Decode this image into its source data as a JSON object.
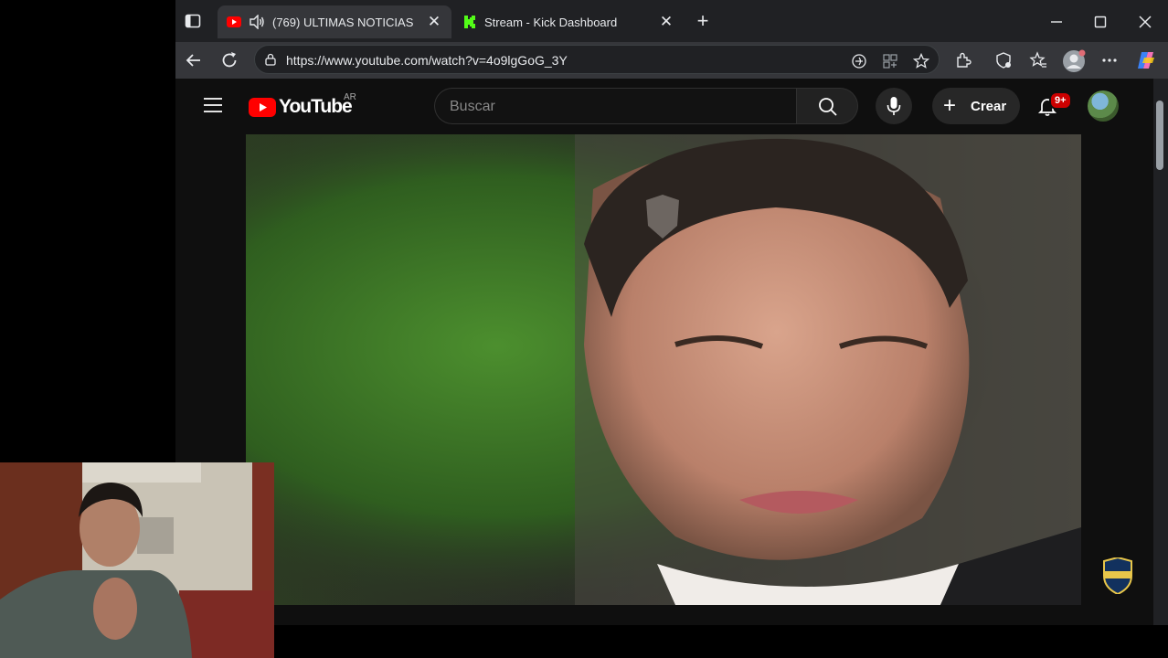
{
  "browser": {
    "tabs": [
      {
        "title": "ULTIMAS NOTICIAS",
        "count": "(769)",
        "active": true
      },
      {
        "title": "Stream - Kick Dashboard",
        "active": false
      }
    ],
    "url": "https://www.youtube.com/watch?v=4o9lgGoG_3Y",
    "close_glyph": "✕",
    "new_tab_glyph": "+"
  },
  "youtube": {
    "logo_text": "YouTube",
    "country_code": "AR",
    "search_placeholder": "Buscar",
    "create_label": "Crear",
    "notifications_badge": "9+"
  },
  "colors": {
    "youtube_red": "#ff0000",
    "kick_green": "#53fc18",
    "badge_red": "#cc0000"
  },
  "icons": [
    "tab-actions-icon",
    "youtube-favicon",
    "speaker-icon",
    "kick-favicon",
    "back-icon",
    "reload-icon",
    "lock-icon",
    "star-icon",
    "extensions-icon",
    "favorites-icon",
    "profile-icon",
    "more-icon",
    "copilot-icon",
    "menu-icon",
    "search-icon",
    "mic-icon",
    "bell-icon"
  ]
}
